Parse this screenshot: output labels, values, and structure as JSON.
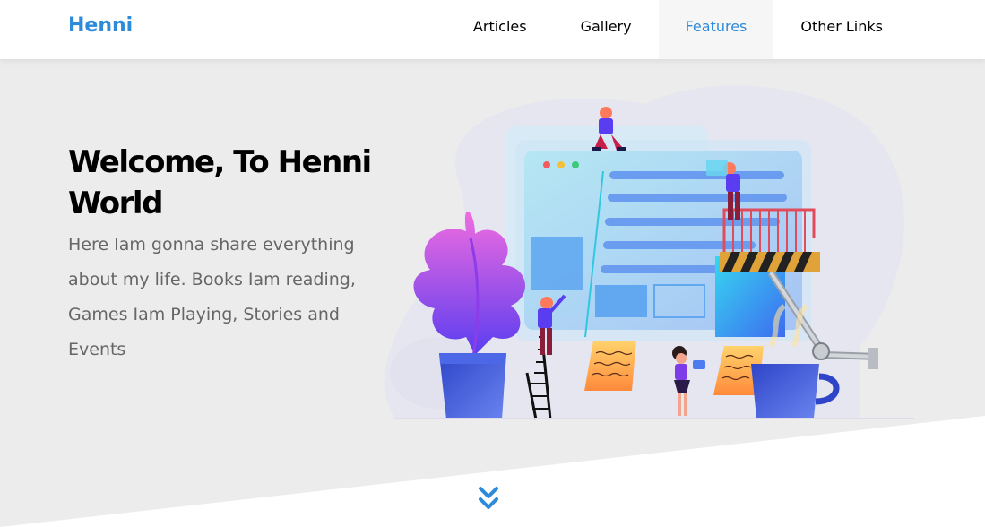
{
  "header": {
    "logo": "Henni",
    "nav": [
      {
        "label": "Articles",
        "active": false
      },
      {
        "label": "Gallery",
        "active": false
      },
      {
        "label": "Features",
        "active": true
      },
      {
        "label": "Other Links",
        "active": false
      }
    ]
  },
  "landing": {
    "title": "Welcome, To Henni World",
    "text": "Here Iam gonna share everything about my life. Books Iam reading, Games Iam Playing, Stories and Events",
    "go_down_icon": "double-chevron-down-icon"
  },
  "colors": {
    "accent": "#2e8bd9",
    "landing_bg": "#ececec",
    "text_muted": "#666666"
  }
}
